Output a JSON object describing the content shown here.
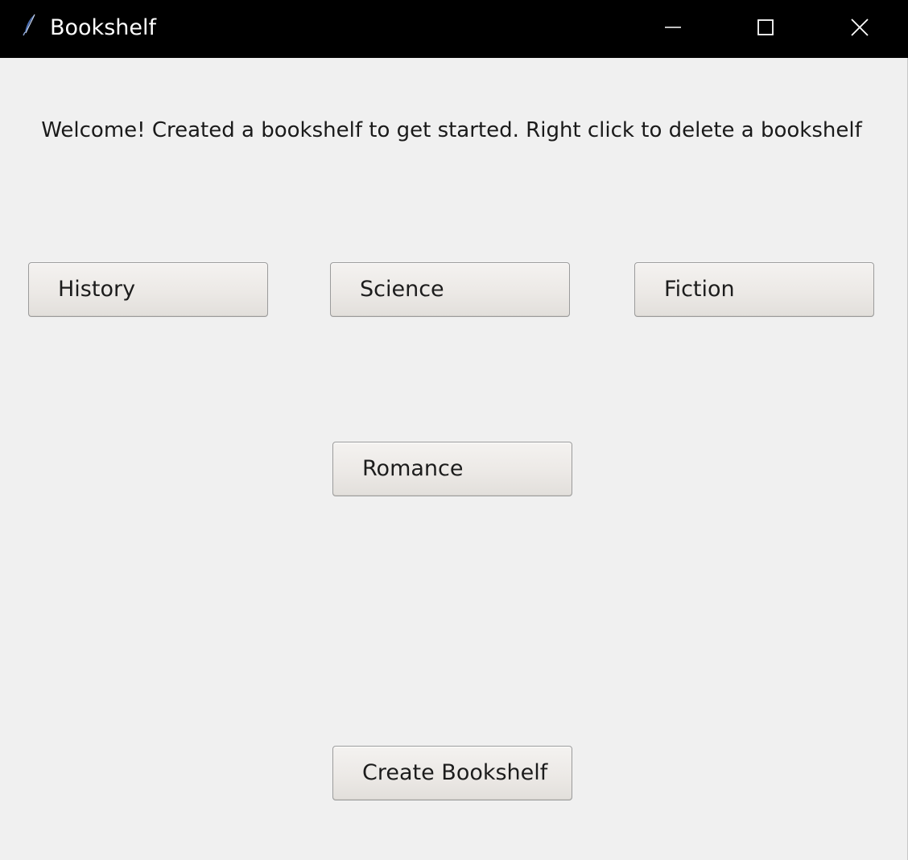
{
  "window": {
    "title": "Bookshelf",
    "app_icon": "feather-icon",
    "controls": {
      "minimize_icon": "minimize-icon",
      "maximize_icon": "maximize-icon",
      "close_icon": "close-icon"
    }
  },
  "main": {
    "welcome_text": "Welcome! Created a bookshelf to get started. Right click to delete a bookshelf",
    "bookshelves": [
      {
        "label": "History"
      },
      {
        "label": "Science"
      },
      {
        "label": "Fiction"
      },
      {
        "label": "Romance"
      }
    ],
    "create_button_label": "Create Bookshelf"
  },
  "colors": {
    "titlebar_bg": "#000000",
    "titlebar_text": "#ffffff",
    "window_bg": "#f0f0f0",
    "button_bg": "#ece9e6",
    "button_border": "#9b9b9b",
    "text": "#1c1c1c",
    "icon_accent": "#4a6fb5"
  }
}
